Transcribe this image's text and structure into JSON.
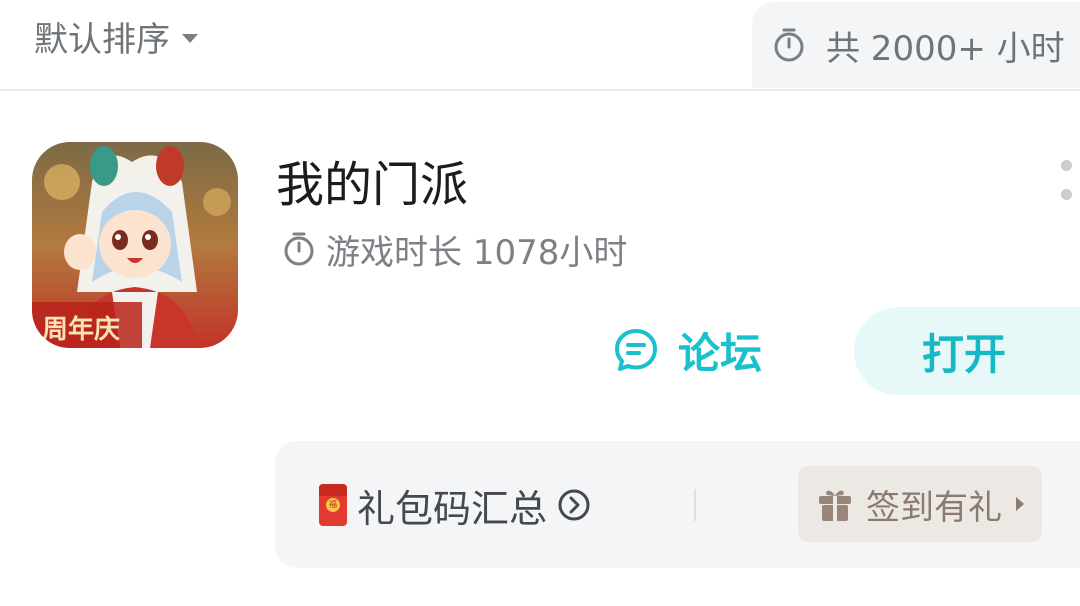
{
  "header": {
    "sort_label": "默认排序",
    "total_label": "共 2000+ 小时"
  },
  "game": {
    "title": "我的门派",
    "playtime": "游戏时长 1078小时",
    "icon_badge": "周年庆",
    "forum_label": "论坛",
    "open_label": "打开"
  },
  "gifts": {
    "code_label": "礼包码汇总",
    "redpacket_char": "福",
    "checkin_label": "签到有礼"
  },
  "colors": {
    "accent": "#1ac0cc",
    "open_bg": "#e7f8f9",
    "checkin_text": "#8a7a70"
  },
  "icons": [
    "chevron-down-icon",
    "timer-icon",
    "more-icon",
    "chat-icon",
    "red-packet-icon",
    "arrow-right-circle-icon",
    "gift-icon",
    "triangle-right-icon"
  ]
}
